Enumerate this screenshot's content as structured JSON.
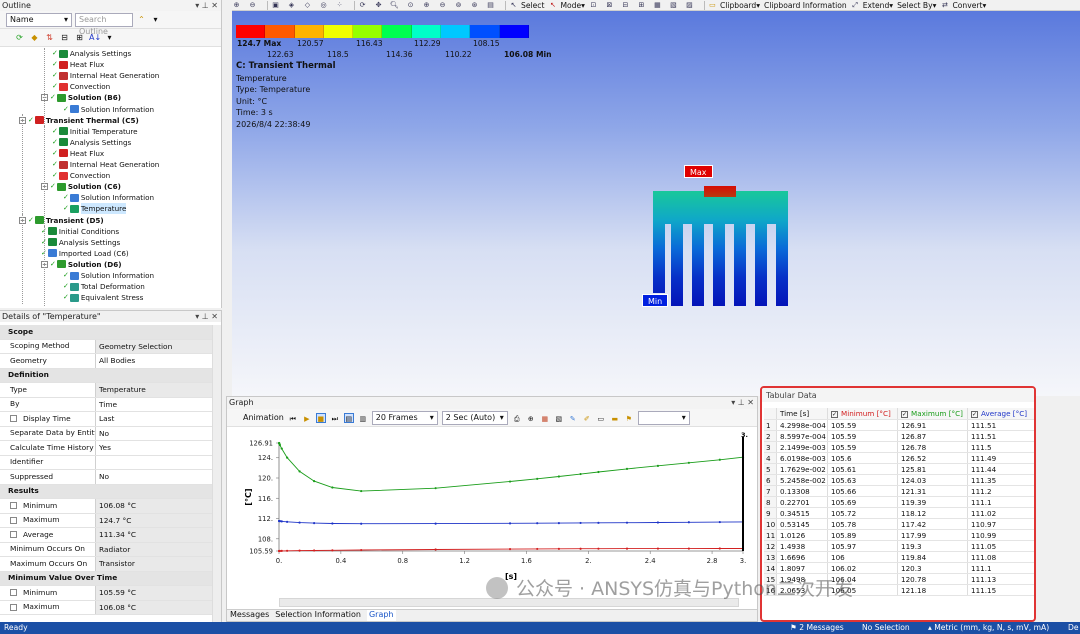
{
  "outline": {
    "title": "Outline",
    "name_combo": "Name",
    "search_placeholder": "Search Outline",
    "tree": [
      {
        "label": "Analysis Settings",
        "indent": 4,
        "bold": false,
        "icon": "settings-icon"
      },
      {
        "label": "Heat Flux",
        "indent": 4,
        "bold": false,
        "icon": "heat-flux-icon"
      },
      {
        "label": "Internal Heat Generation",
        "indent": 4,
        "bold": false,
        "icon": "heat-gen-icon"
      },
      {
        "label": "Convection",
        "indent": 4,
        "bold": false,
        "icon": "convection-icon"
      },
      {
        "label": "Solution (B6)",
        "indent": 3,
        "bold": true,
        "icon": "solution-icon"
      },
      {
        "label": "Solution Information",
        "indent": 5,
        "bold": false,
        "icon": "info-icon"
      },
      {
        "label": "Transient Thermal (C5)",
        "indent": 1,
        "bold": true,
        "icon": "thermal-icon"
      },
      {
        "label": "Initial Temperature",
        "indent": 4,
        "bold": false,
        "icon": "settings-icon"
      },
      {
        "label": "Analysis Settings",
        "indent": 4,
        "bold": false,
        "icon": "settings-icon"
      },
      {
        "label": "Heat Flux",
        "indent": 4,
        "bold": false,
        "icon": "heat-flux-icon"
      },
      {
        "label": "Internal Heat Generation",
        "indent": 4,
        "bold": false,
        "icon": "heat-gen-icon"
      },
      {
        "label": "Convection",
        "indent": 4,
        "bold": false,
        "icon": "convection-icon"
      },
      {
        "label": "Solution (C6)",
        "indent": 3,
        "bold": true,
        "icon": "solution-icon"
      },
      {
        "label": "Solution Information",
        "indent": 5,
        "bold": false,
        "icon": "info-icon"
      },
      {
        "label": "Temperature",
        "indent": 5,
        "bold": false,
        "icon": "temperature-icon",
        "selected": true
      },
      {
        "label": "Transient (D5)",
        "indent": 1,
        "bold": true,
        "icon": "transient-icon"
      },
      {
        "label": "Initial Conditions",
        "indent": 3,
        "bold": false,
        "icon": "settings-icon"
      },
      {
        "label": "Analysis Settings",
        "indent": 3,
        "bold": false,
        "icon": "settings-icon"
      },
      {
        "label": "Imported Load (C6)",
        "indent": 3,
        "bold": false,
        "icon": "import-icon"
      },
      {
        "label": "Solution (D6)",
        "indent": 3,
        "bold": true,
        "icon": "solution-icon"
      },
      {
        "label": "Solution Information",
        "indent": 5,
        "bold": false,
        "icon": "info-icon"
      },
      {
        "label": "Total Deformation",
        "indent": 5,
        "bold": false,
        "icon": "result-icon"
      },
      {
        "label": "Equivalent Stress",
        "indent": 5,
        "bold": false,
        "icon": "result-icon"
      }
    ]
  },
  "details": {
    "title": "Details of \"Temperature\"",
    "rows": [
      {
        "type": "section",
        "k": "Scope"
      },
      {
        "k": "Scoping Method",
        "v": "Geometry Selection",
        "grey": true
      },
      {
        "k": "Geometry",
        "v": "All Bodies"
      },
      {
        "type": "section",
        "k": "Definition"
      },
      {
        "k": "Type",
        "v": "Temperature",
        "grey": true
      },
      {
        "k": "By",
        "v": "Time"
      },
      {
        "k": "Display Time",
        "v": "Last",
        "check": true
      },
      {
        "k": "Separate Data by Entity",
        "v": "No"
      },
      {
        "k": "Calculate Time History",
        "v": "Yes"
      },
      {
        "k": "Identifier",
        "v": ""
      },
      {
        "k": "Suppressed",
        "v": "No"
      },
      {
        "type": "section",
        "k": "Results"
      },
      {
        "k": "Minimum",
        "v": "106.08 °C",
        "check": true,
        "grey": true
      },
      {
        "k": "Maximum",
        "v": "124.7 °C",
        "check": true,
        "grey": true
      },
      {
        "k": "Average",
        "v": "111.34 °C",
        "check": true,
        "grey": true
      },
      {
        "k": "Minimum Occurs On",
        "v": "Radiator",
        "grey": true
      },
      {
        "k": "Maximum Occurs On",
        "v": "Transistor",
        "grey": true
      },
      {
        "type": "section",
        "k": "Minimum Value Over Time"
      },
      {
        "k": "Minimum",
        "v": "105.59 °C",
        "check": true,
        "grey": true
      },
      {
        "k": "Maximum",
        "v": "106.08 °C",
        "check": true,
        "grey": true
      }
    ]
  },
  "toolbar": {
    "items": [
      "Select",
      "Mode",
      "Clipboard",
      "Clipboard Information",
      "Extend",
      "Select By",
      "Convert"
    ]
  },
  "legend": {
    "colors": [
      "#ff0000",
      "#ff5a00",
      "#ffb400",
      "#f0ff00",
      "#96ff00",
      "#00ff50",
      "#00ffc8",
      "#00c8ff",
      "#0050ff",
      "#0000ff"
    ],
    "max_label": "124.7 Max",
    "min_label": "106.08 Min",
    "top_ticks": [
      "120.57",
      "116.43",
      "112.29",
      "108.15"
    ],
    "bottom_ticks": [
      "122.63",
      "118.5",
      "114.36",
      "110.22"
    ]
  },
  "result_info": {
    "title": "C: Transient Thermal",
    "lines": [
      "Temperature",
      "Type: Temperature",
      "Unit: °C",
      "Time: 3 s",
      "2026/8/4 22:38:49"
    ]
  },
  "probes": {
    "max": "Max",
    "min": "Min"
  },
  "graph": {
    "title": "Graph",
    "animation_label": "Animation",
    "frames": "20 Frames",
    "duration": "2 Sec (Auto)",
    "tabs": [
      "Messages",
      "Selection Information",
      "Graph"
    ],
    "active_tab": "Graph"
  },
  "chart_data": {
    "type": "line",
    "xlabel": "[s]",
    "ylabel": "[°C]",
    "xlim": [
      0,
      3
    ],
    "ylim": [
      105.59,
      126.91
    ],
    "y_ticks": [
      "126.91",
      "124.",
      "120.",
      "116.",
      "112.",
      "108.",
      "105.59"
    ],
    "x_ticks": [
      "0.",
      "0.4",
      "0.8",
      "1.2",
      "1.6",
      "2.",
      "2.4",
      "2.8",
      "3."
    ],
    "series": [
      {
        "name": "Maximum [°C]",
        "color": "#1a9d1a",
        "x": [
          0.00043,
          0.00086,
          0.00215,
          0.00602,
          0.01763,
          0.05246,
          0.13308,
          0.22701,
          0.34515,
          0.53145,
          1.0126,
          1.4938,
          1.6696,
          1.8097,
          1.9498,
          2.0653,
          2.25,
          2.45,
          2.65,
          2.85,
          3.0
        ],
        "y": [
          126.91,
          126.87,
          126.78,
          126.52,
          125.81,
          124.03,
          121.31,
          119.39,
          118.12,
          117.42,
          117.99,
          119.3,
          119.84,
          120.3,
          120.78,
          121.18,
          121.8,
          122.4,
          123.0,
          123.6,
          124.1
        ]
      },
      {
        "name": "Average [°C]",
        "color": "#1f35c8",
        "x": [
          0.00043,
          0.00086,
          0.00215,
          0.00602,
          0.01763,
          0.05246,
          0.13308,
          0.22701,
          0.34515,
          0.53145,
          1.0126,
          1.4938,
          1.6696,
          1.8097,
          1.9498,
          2.0653,
          2.25,
          2.45,
          2.65,
          2.85,
          3.0
        ],
        "y": [
          111.51,
          111.51,
          111.5,
          111.49,
          111.44,
          111.35,
          111.2,
          111.1,
          111.02,
          110.97,
          110.99,
          111.05,
          111.08,
          111.1,
          111.13,
          111.15,
          111.18,
          111.22,
          111.26,
          111.3,
          111.34
        ]
      },
      {
        "name": "Minimum [°C]",
        "color": "#d22020",
        "x": [
          0.00043,
          0.00086,
          0.00215,
          0.00602,
          0.01763,
          0.05246,
          0.13308,
          0.22701,
          0.34515,
          0.53145,
          1.0126,
          1.4938,
          1.6696,
          1.8097,
          1.9498,
          2.0653,
          2.25,
          2.45,
          2.65,
          2.85,
          3.0
        ],
        "y": [
          105.59,
          105.59,
          105.59,
          105.6,
          105.61,
          105.63,
          105.66,
          105.69,
          105.72,
          105.78,
          105.89,
          105.97,
          106.0,
          106.02,
          106.04,
          106.05,
          106.06,
          106.07,
          106.07,
          106.08,
          106.08
        ]
      }
    ]
  },
  "tabular": {
    "title": "Tabular Data",
    "headers": [
      "",
      "Time [s]",
      "Minimum [°C]",
      "Maximum [°C]",
      "Average [°C]"
    ],
    "header_colors": [
      "#111",
      "#111",
      "#d22020",
      "#1a9d1a",
      "#1f35c8"
    ],
    "rows": [
      [
        "1",
        "4.2998e-004",
        "105.59",
        "126.91",
        "111.51"
      ],
      [
        "2",
        "8.5997e-004",
        "105.59",
        "126.87",
        "111.51"
      ],
      [
        "3",
        "2.1499e-003",
        "105.59",
        "126.78",
        "111.5"
      ],
      [
        "4",
        "6.0198e-003",
        "105.6",
        "126.52",
        "111.49"
      ],
      [
        "5",
        "1.7629e-002",
        "105.61",
        "125.81",
        "111.44"
      ],
      [
        "6",
        "5.2458e-002",
        "105.63",
        "124.03",
        "111.35"
      ],
      [
        "7",
        "0.13308",
        "105.66",
        "121.31",
        "111.2"
      ],
      [
        "8",
        "0.22701",
        "105.69",
        "119.39",
        "111.1"
      ],
      [
        "9",
        "0.34515",
        "105.72",
        "118.12",
        "111.02"
      ],
      [
        "10",
        "0.53145",
        "105.78",
        "117.42",
        "110.97"
      ],
      [
        "11",
        "1.0126",
        "105.89",
        "117.99",
        "110.99"
      ],
      [
        "12",
        "1.4938",
        "105.97",
        "119.3",
        "111.05"
      ],
      [
        "13",
        "1.6696",
        "106",
        "119.84",
        "111.08"
      ],
      [
        "14",
        "1.8097",
        "106.02",
        "120.3",
        "111.1"
      ],
      [
        "15",
        "1.9498",
        "106.04",
        "120.78",
        "111.13"
      ],
      [
        "16",
        "2.0653",
        "106.05",
        "121.18",
        "111.15"
      ]
    ]
  },
  "status": {
    "ready": "Ready",
    "messages": "2 Messages",
    "selection": "No Selection",
    "units": "Metric (mm, kg, N, s, mV, mA)",
    "last": "De"
  },
  "watermark": "公众号 · ANSYS仿真与Python二次开发"
}
